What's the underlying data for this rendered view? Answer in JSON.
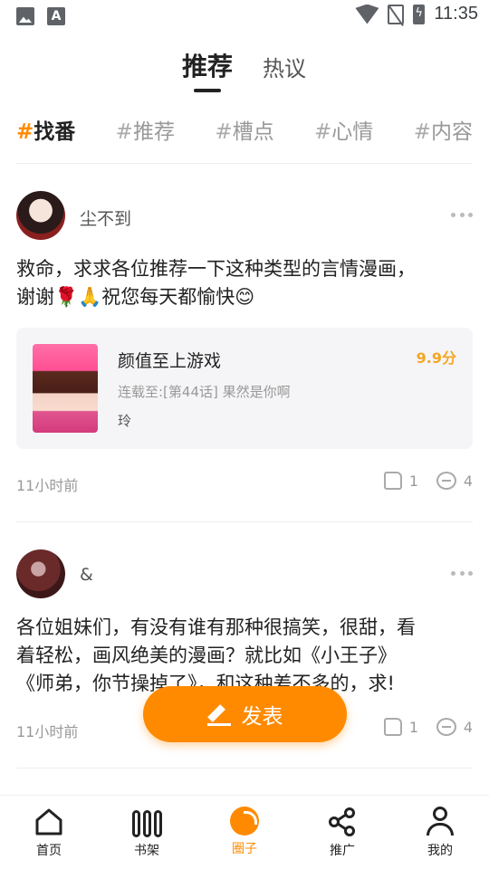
{
  "status_bar": {
    "time": "11:35",
    "icons": [
      "image-icon",
      "a-icon",
      "wifi-icon",
      "no-sim-icon",
      "battery-charging-icon"
    ]
  },
  "top_tabs": [
    {
      "label": "推荐",
      "active": true
    },
    {
      "label": "热议",
      "active": false
    }
  ],
  "hashtags": [
    {
      "hash": "#",
      "label": "找番",
      "active": true
    },
    {
      "hash": "#",
      "label": "推荐",
      "active": false
    },
    {
      "hash": "#",
      "label": "槽点",
      "active": false
    },
    {
      "hash": "#",
      "label": "心情",
      "active": false
    },
    {
      "hash": "#",
      "label": "内容",
      "active": false
    }
  ],
  "posts": [
    {
      "username": "尘不到",
      "content_line1": "救命，求求各位推荐一下这种类型的言情漫画，",
      "content_line2": "谢谢🌹🙏祝您每天都愉快😊",
      "book": {
        "title": "颜值至上游戏",
        "score": "9.9分",
        "subtitle": "连载至:[第44话] 果然是你啊",
        "author": "玲"
      },
      "time": "11小时前",
      "likes": "1",
      "comments": "4"
    },
    {
      "username": "&",
      "content_line1": "各位姐妹们，有没有谁有那种很搞笑，很甜，看",
      "content_line2": "着轻松，画风绝美的漫画？就比如《小王子》",
      "content_line3": "《师弟，你节操掉了》，和这种差不多的，求!",
      "time": "11小时前",
      "likes": "1",
      "comments": "4"
    }
  ],
  "fab": {
    "label": "发表"
  },
  "bottom_nav": [
    {
      "label": "首页",
      "icon": "home-icon",
      "active": false
    },
    {
      "label": "书架",
      "icon": "bookshelf-icon",
      "active": false
    },
    {
      "label": "圈子",
      "icon": "circle-icon",
      "active": true
    },
    {
      "label": "推广",
      "icon": "share-icon",
      "active": false
    },
    {
      "label": "我的",
      "icon": "user-icon",
      "active": false
    }
  ],
  "colors": {
    "accent": "#ff8a00",
    "score": "#f5a623",
    "muted": "#999999"
  }
}
